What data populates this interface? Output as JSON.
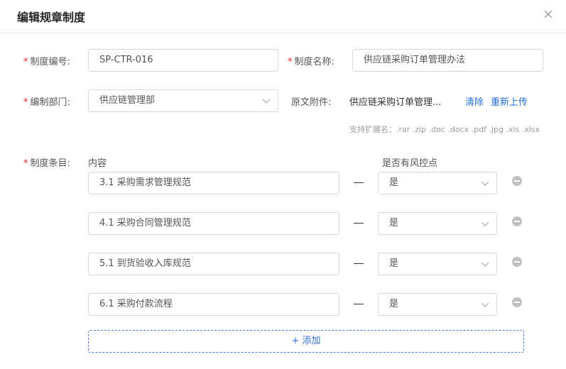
{
  "dialog": {
    "title": "编辑规章制度"
  },
  "form": {
    "code": {
      "label": "制度编号:",
      "value": "SP-CTR-016"
    },
    "name": {
      "label": "制度名称:",
      "value": "供应链采购订单管理办法"
    },
    "department": {
      "label": "编制部门:",
      "value": "供应链管理部"
    },
    "attachment": {
      "label": "原文附件:",
      "filename": "供应链采购订单管理...",
      "clear_label": "清除",
      "reupload_label": "重新上传",
      "hint": "支持扩展名：.rar .zip .doc .docx .pdf .jpg .xls .xlsx"
    },
    "clauses": {
      "label": "制度条目:",
      "content_header": "内容",
      "risk_header": "是否有风控点",
      "rows": [
        {
          "content": "3.1   采购需求管理规范",
          "risk": "是"
        },
        {
          "content": "4.1   采购合同管理规范",
          "risk": "是"
        },
        {
          "content": "5.1   到货验收入库规范",
          "risk": "是"
        },
        {
          "content": "6.1   采购付款流程",
          "risk": "是"
        }
      ],
      "add_label": "+ 添加"
    }
  },
  "icons": {
    "close": "close-icon",
    "dropdown": "chevron-down-icon",
    "remove": "remove-circle-icon"
  },
  "colors": {
    "required": "#f5222d",
    "link": "#1f6fe5",
    "border": "#d9d9d9"
  }
}
